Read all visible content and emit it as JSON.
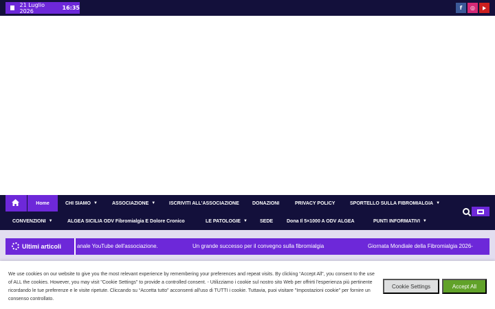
{
  "topbar": {
    "date": "21 Luglio 2026",
    "time": "16:35",
    "social": [
      {
        "name": "facebook-icon",
        "glyph": "f"
      },
      {
        "name": "instagram-icon",
        "glyph": "◎"
      },
      {
        "name": "youtube-icon",
        "glyph": ""
      }
    ]
  },
  "nav": {
    "home_label": "Home",
    "row1": [
      {
        "label": "CHI SIAMO",
        "caret": true
      },
      {
        "label": "ASSOCIAZIONE",
        "caret": true
      },
      {
        "label": "ISCRIVITI ALL'ASSOCIAZIONE",
        "caret": false
      },
      {
        "label": "DONAZIONI",
        "caret": false
      },
      {
        "label": "PRIVACY POLICY",
        "caret": false
      },
      {
        "label": "SPORTELLO SULLA FIBROMIALGIA",
        "caret": true
      }
    ],
    "row2": [
      {
        "label": "CONVENZIONI",
        "caret": true
      },
      {
        "label": "ALGEA SICILIA ODV Fibromialgia E Dolore Cronico",
        "caret": false
      },
      {
        "label": "LE PATOLOGIE",
        "caret": true
      },
      {
        "label": "SEDE",
        "caret": false
      },
      {
        "label": "Dona Il 5×1000 A ODV ALGEA",
        "caret": false
      },
      {
        "label": "PUNTI INFORMATIVI",
        "caret": true
      }
    ]
  },
  "ticker": {
    "label": "Ultimi articoli",
    "items": [
      "anale YouTube dell'associazione.",
      "Un grande successo per il convegno sulla fibromialgia",
      "Giornata Mondiale della Fibromialgia 2026-"
    ]
  },
  "cookie": {
    "text": "We use cookies on our website to give you the most relevant experience by remembering your preferences and repeat visits. By clicking “Accept All”, you consent to the use of ALL the cookies. However, you may visit \"Cookie Settings\" to provide a controlled consent. - Utilizziamo i cookie sul nostro sito Web per offrirti l'esperienza più pertinente ricordando le tue preferenze e le visite ripetute. Cliccando su “Accetta tutto” acconsenti all'uso di TUTTI i cookie. Tuttavia, puoi visitare \"Impostazioni cookie\" per fornire un consenso controllato.",
    "settings_label": "Cookie Settings",
    "accept_label": "Accept All"
  },
  "colors": {
    "navy": "#13103b",
    "purple": "#6d28d9",
    "accept_green": "#61a229"
  }
}
